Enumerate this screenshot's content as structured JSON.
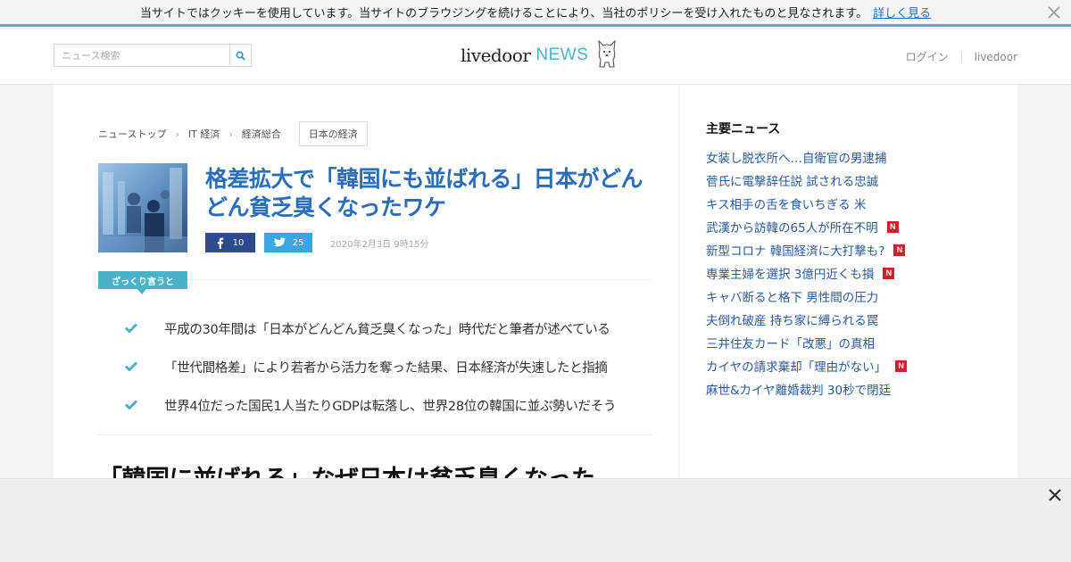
{
  "cookie": {
    "message": "当サイトではクッキーを使用しています。当サイトのブラウジングを続けることにより、当社のポリシーを受け入れたものと見なされます。",
    "link": "詳しく見る",
    "close_icon": "close-icon"
  },
  "header": {
    "search_placeholder": "ニュース検索",
    "search_icon": "search-icon",
    "logo_livedoor": "livedoor",
    "logo_news": "NEWS",
    "login": "ログイン",
    "livedoor_link": "livedoor"
  },
  "breadcrumb": {
    "items": [
      "ニューストップ",
      "IT 経済",
      "経済総合"
    ],
    "tag": "日本の経済"
  },
  "article": {
    "title": "格差拡大で「韓国にも並ばれる」日本がどんどん貧乏臭くなったワケ",
    "facebook_count": "10",
    "twitter_count": "25",
    "date": "2020年2月3日 9時15分",
    "summary_label": "ざっくり言うと",
    "summary": [
      "平成の30年間は「日本がどんどん貧乏臭くなった」時代だと筆者が述べている",
      "「世代間格差」により若者から活力を奪った結果、日本経済が失速したと指摘",
      "世界4位だった国民1人当たりGDPは転落し、世界28位の韓国に並ぶ勢いだそう"
    ],
    "body_heading": "「韓国に並ばれる」なぜ日本は貧乏臭くなった"
  },
  "sidebar": {
    "title": "主要ニュース",
    "news": [
      {
        "text": "女装し脱衣所へ…自衛官の男逮捕",
        "badge": ""
      },
      {
        "text": "菅氏に電撃辞任説 試される忠誠",
        "badge": ""
      },
      {
        "text": "キス相手の舌を食いちぎる 米",
        "badge": ""
      },
      {
        "text": "武漢から訪韓の65人が所在不明",
        "badge": "N"
      },
      {
        "text": "新型コロナ 韓国経済に大打撃も?",
        "badge": "N"
      },
      {
        "text": "専業主婦を選択 3億円近くも損",
        "badge": "N"
      },
      {
        "text": "キャバ断ると格下 男性間の圧力",
        "badge": ""
      },
      {
        "text": "夫倒れ破産 持ち家に縛られる罠",
        "badge": ""
      },
      {
        "text": "三井住友カード「改悪」の真相",
        "badge": ""
      },
      {
        "text": "カイヤの請求棄却「理由がない」",
        "badge": "N"
      },
      {
        "text": "麻世&カイヤ離婚裁判 30秒で閉廷",
        "badge": ""
      }
    ]
  },
  "colors": {
    "accent": "#4ab3c8",
    "link": "#2a6ebb",
    "facebook": "#2c4a8c",
    "twitter": "#3ba7e0",
    "badge": "#d21f2b"
  }
}
